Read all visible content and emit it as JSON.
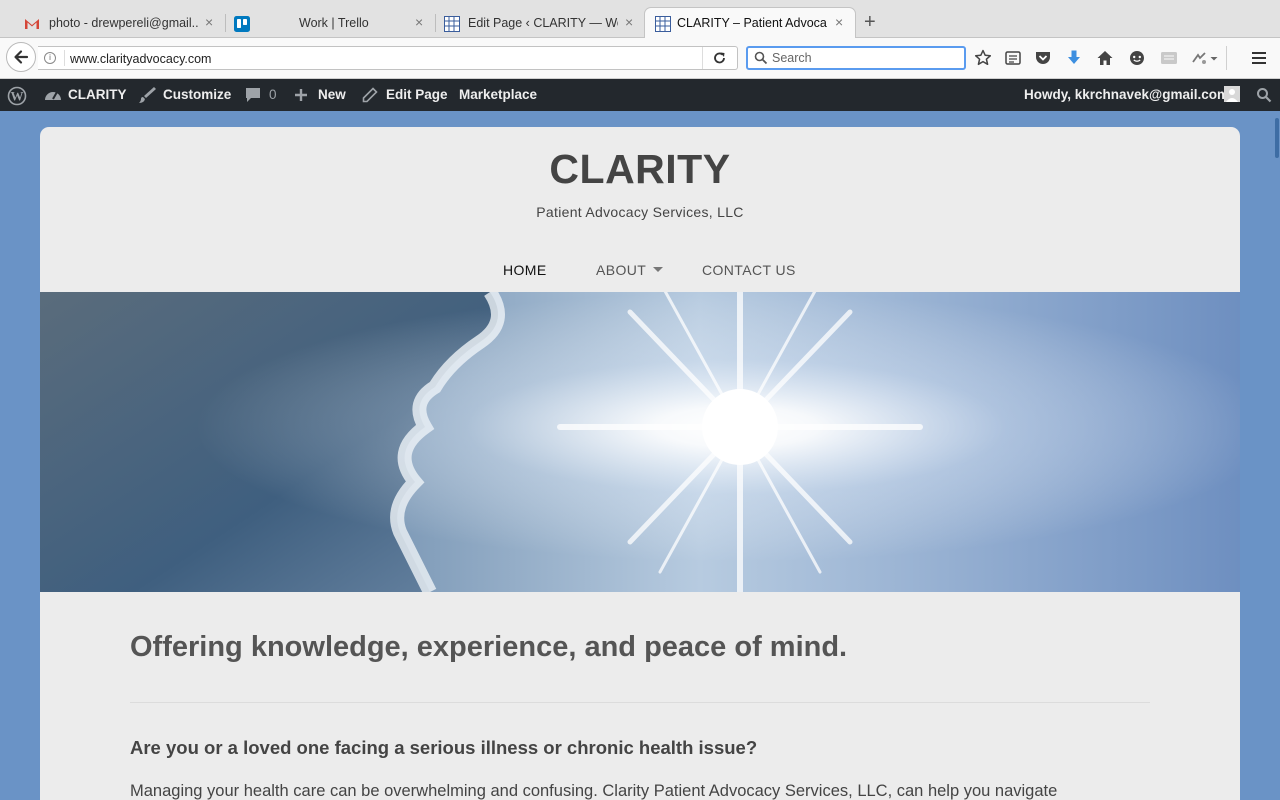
{
  "browser": {
    "tabs": [
      {
        "title": "photo - drewpereli@gmail....",
        "icon": "gmail-icon"
      },
      {
        "title": "Work | Trello",
        "icon": "trello-icon"
      },
      {
        "title": "Edit Page ‹ CLARITY — Wo...",
        "icon": "site-icon"
      },
      {
        "title": "CLARITY – Patient Advocac...",
        "icon": "site-icon",
        "active": true
      }
    ],
    "close_glyph": "×",
    "new_tab_glyph": "+",
    "url": "www.clarityadvocacy.com",
    "search_placeholder": "Search",
    "accent": "#5a9bef"
  },
  "adminbar": {
    "site_name": "CLARITY",
    "customize": "Customize",
    "comments_count": "0",
    "new_label": "New",
    "edit_page": "Edit Page",
    "marketplace": "Marketplace",
    "howdy": "Howdy, kkrchnavek@gmail.com"
  },
  "site": {
    "title": "CLARITY",
    "tagline": "Patient Advocacy Services, LLC",
    "menu": {
      "home": "HOME",
      "about": "ABOUT",
      "contact": "CONTACT US"
    },
    "hero_alt": "",
    "heading": "Offering knowledge, experience, and peace of mind.",
    "subheading": "Are you or a loved one facing a serious illness or chronic health issue?",
    "paragraph": "Managing your health care can be overwhelming and confusing.  Clarity Patient Advocacy Services, LLC, can help you navigate"
  },
  "colors": {
    "page_bg": "#6a93c6",
    "adminbar_bg": "#23282d",
    "site_bg": "#ececec"
  }
}
